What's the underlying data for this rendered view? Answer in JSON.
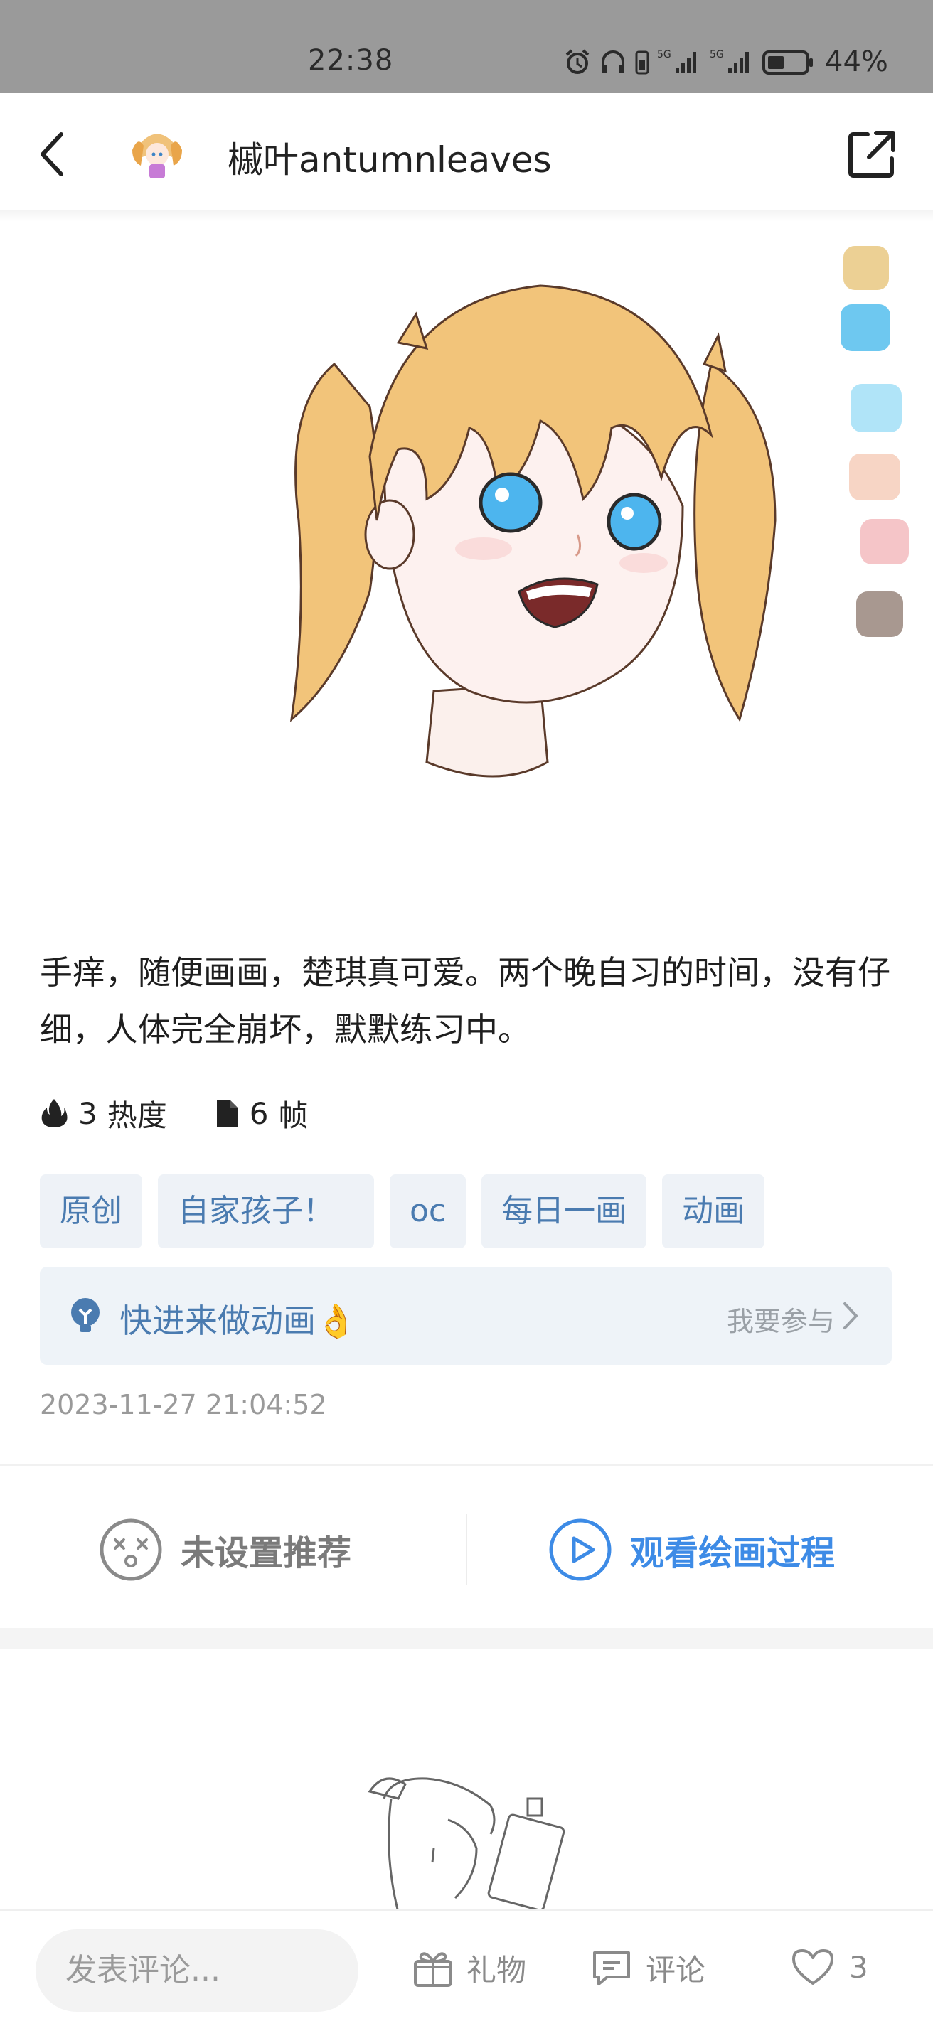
{
  "status_bar": {
    "time": "22:38",
    "battery": "44%"
  },
  "header": {
    "username": "槭叶antumnleaves"
  },
  "palette": [
    "#ecd094",
    "#6ec8f0",
    "#b0e4f8",
    "#f7d5c5",
    "#f5c5c8",
    "#a89890"
  ],
  "post": {
    "description": "手痒，随便画画，楚琪真可爱。两个晚自习的时间，没有仔细，人体完全崩坏，默默练习中。",
    "heat_value": "3",
    "heat_label": "热度",
    "frames_value": "6",
    "frames_label": "帧",
    "tags": [
      "原创",
      "自家孩子！",
      "oc",
      "每日一画",
      "动画"
    ],
    "activity": {
      "title": "快进来做动画👌",
      "join": "我要参与"
    },
    "timestamp": "2023-11-27 21:04:52"
  },
  "actions": {
    "recommend": "未设置推荐",
    "watch": "观看绘画过程"
  },
  "bottom_bar": {
    "comment_placeholder": "发表评论...",
    "gift": "礼物",
    "comment": "评论",
    "likes": "3"
  }
}
